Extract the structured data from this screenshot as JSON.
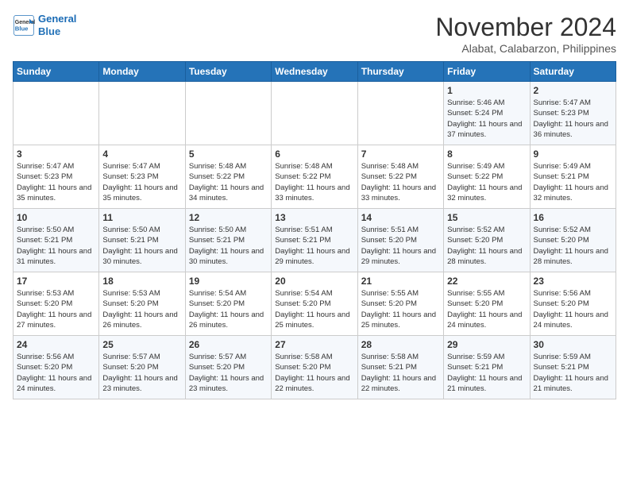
{
  "header": {
    "logo_line1": "General",
    "logo_line2": "Blue",
    "month_title": "November 2024",
    "location": "Alabat, Calabarzon, Philippines"
  },
  "weekdays": [
    "Sunday",
    "Monday",
    "Tuesday",
    "Wednesday",
    "Thursday",
    "Friday",
    "Saturday"
  ],
  "weeks": [
    [
      {
        "day": "",
        "sunrise": "",
        "sunset": "",
        "daylight": ""
      },
      {
        "day": "",
        "sunrise": "",
        "sunset": "",
        "daylight": ""
      },
      {
        "day": "",
        "sunrise": "",
        "sunset": "",
        "daylight": ""
      },
      {
        "day": "",
        "sunrise": "",
        "sunset": "",
        "daylight": ""
      },
      {
        "day": "",
        "sunrise": "",
        "sunset": "",
        "daylight": ""
      },
      {
        "day": "1",
        "sunrise": "Sunrise: 5:46 AM",
        "sunset": "Sunset: 5:24 PM",
        "daylight": "Daylight: 11 hours and 37 minutes."
      },
      {
        "day": "2",
        "sunrise": "Sunrise: 5:47 AM",
        "sunset": "Sunset: 5:23 PM",
        "daylight": "Daylight: 11 hours and 36 minutes."
      }
    ],
    [
      {
        "day": "3",
        "sunrise": "Sunrise: 5:47 AM",
        "sunset": "Sunset: 5:23 PM",
        "daylight": "Daylight: 11 hours and 35 minutes."
      },
      {
        "day": "4",
        "sunrise": "Sunrise: 5:47 AM",
        "sunset": "Sunset: 5:23 PM",
        "daylight": "Daylight: 11 hours and 35 minutes."
      },
      {
        "day": "5",
        "sunrise": "Sunrise: 5:48 AM",
        "sunset": "Sunset: 5:22 PM",
        "daylight": "Daylight: 11 hours and 34 minutes."
      },
      {
        "day": "6",
        "sunrise": "Sunrise: 5:48 AM",
        "sunset": "Sunset: 5:22 PM",
        "daylight": "Daylight: 11 hours and 33 minutes."
      },
      {
        "day": "7",
        "sunrise": "Sunrise: 5:48 AM",
        "sunset": "Sunset: 5:22 PM",
        "daylight": "Daylight: 11 hours and 33 minutes."
      },
      {
        "day": "8",
        "sunrise": "Sunrise: 5:49 AM",
        "sunset": "Sunset: 5:22 PM",
        "daylight": "Daylight: 11 hours and 32 minutes."
      },
      {
        "day": "9",
        "sunrise": "Sunrise: 5:49 AM",
        "sunset": "Sunset: 5:21 PM",
        "daylight": "Daylight: 11 hours and 32 minutes."
      }
    ],
    [
      {
        "day": "10",
        "sunrise": "Sunrise: 5:50 AM",
        "sunset": "Sunset: 5:21 PM",
        "daylight": "Daylight: 11 hours and 31 minutes."
      },
      {
        "day": "11",
        "sunrise": "Sunrise: 5:50 AM",
        "sunset": "Sunset: 5:21 PM",
        "daylight": "Daylight: 11 hours and 30 minutes."
      },
      {
        "day": "12",
        "sunrise": "Sunrise: 5:50 AM",
        "sunset": "Sunset: 5:21 PM",
        "daylight": "Daylight: 11 hours and 30 minutes."
      },
      {
        "day": "13",
        "sunrise": "Sunrise: 5:51 AM",
        "sunset": "Sunset: 5:21 PM",
        "daylight": "Daylight: 11 hours and 29 minutes."
      },
      {
        "day": "14",
        "sunrise": "Sunrise: 5:51 AM",
        "sunset": "Sunset: 5:20 PM",
        "daylight": "Daylight: 11 hours and 29 minutes."
      },
      {
        "day": "15",
        "sunrise": "Sunrise: 5:52 AM",
        "sunset": "Sunset: 5:20 PM",
        "daylight": "Daylight: 11 hours and 28 minutes."
      },
      {
        "day": "16",
        "sunrise": "Sunrise: 5:52 AM",
        "sunset": "Sunset: 5:20 PM",
        "daylight": "Daylight: 11 hours and 28 minutes."
      }
    ],
    [
      {
        "day": "17",
        "sunrise": "Sunrise: 5:53 AM",
        "sunset": "Sunset: 5:20 PM",
        "daylight": "Daylight: 11 hours and 27 minutes."
      },
      {
        "day": "18",
        "sunrise": "Sunrise: 5:53 AM",
        "sunset": "Sunset: 5:20 PM",
        "daylight": "Daylight: 11 hours and 26 minutes."
      },
      {
        "day": "19",
        "sunrise": "Sunrise: 5:54 AM",
        "sunset": "Sunset: 5:20 PM",
        "daylight": "Daylight: 11 hours and 26 minutes."
      },
      {
        "day": "20",
        "sunrise": "Sunrise: 5:54 AM",
        "sunset": "Sunset: 5:20 PM",
        "daylight": "Daylight: 11 hours and 25 minutes."
      },
      {
        "day": "21",
        "sunrise": "Sunrise: 5:55 AM",
        "sunset": "Sunset: 5:20 PM",
        "daylight": "Daylight: 11 hours and 25 minutes."
      },
      {
        "day": "22",
        "sunrise": "Sunrise: 5:55 AM",
        "sunset": "Sunset: 5:20 PM",
        "daylight": "Daylight: 11 hours and 24 minutes."
      },
      {
        "day": "23",
        "sunrise": "Sunrise: 5:56 AM",
        "sunset": "Sunset: 5:20 PM",
        "daylight": "Daylight: 11 hours and 24 minutes."
      }
    ],
    [
      {
        "day": "24",
        "sunrise": "Sunrise: 5:56 AM",
        "sunset": "Sunset: 5:20 PM",
        "daylight": "Daylight: 11 hours and 24 minutes."
      },
      {
        "day": "25",
        "sunrise": "Sunrise: 5:57 AM",
        "sunset": "Sunset: 5:20 PM",
        "daylight": "Daylight: 11 hours and 23 minutes."
      },
      {
        "day": "26",
        "sunrise": "Sunrise: 5:57 AM",
        "sunset": "Sunset: 5:20 PM",
        "daylight": "Daylight: 11 hours and 23 minutes."
      },
      {
        "day": "27",
        "sunrise": "Sunrise: 5:58 AM",
        "sunset": "Sunset: 5:20 PM",
        "daylight": "Daylight: 11 hours and 22 minutes."
      },
      {
        "day": "28",
        "sunrise": "Sunrise: 5:58 AM",
        "sunset": "Sunset: 5:21 PM",
        "daylight": "Daylight: 11 hours and 22 minutes."
      },
      {
        "day": "29",
        "sunrise": "Sunrise: 5:59 AM",
        "sunset": "Sunset: 5:21 PM",
        "daylight": "Daylight: 11 hours and 21 minutes."
      },
      {
        "day": "30",
        "sunrise": "Sunrise: 5:59 AM",
        "sunset": "Sunset: 5:21 PM",
        "daylight": "Daylight: 11 hours and 21 minutes."
      }
    ]
  ]
}
